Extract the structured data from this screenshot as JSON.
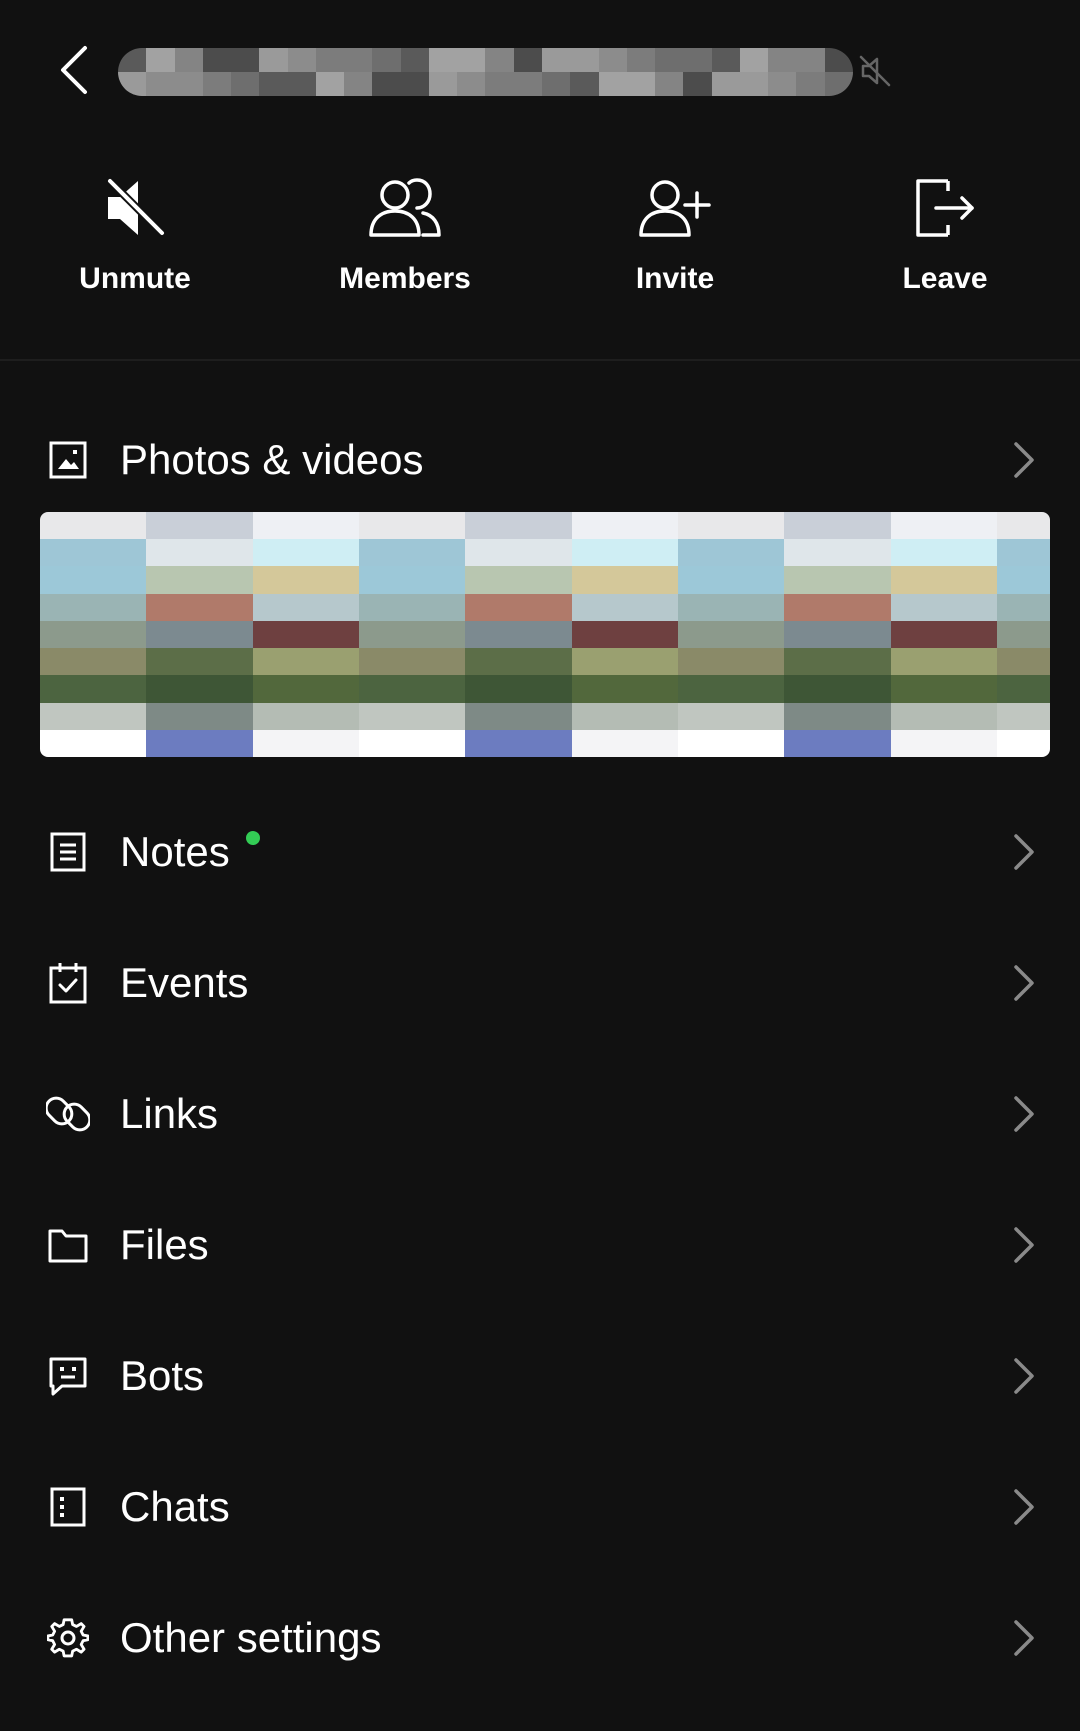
{
  "header": {
    "back_icon": "chevron-left-icon",
    "title_obscured": true,
    "mute_indicator_icon": "speaker-muted-icon"
  },
  "actions": [
    {
      "label": "Unmute",
      "icon": "speaker-muted-icon"
    },
    {
      "label": "Members",
      "icon": "members-icon"
    },
    {
      "label": "Invite",
      "icon": "add-person-icon"
    },
    {
      "label": "Leave",
      "icon": "exit-icon"
    }
  ],
  "menu": {
    "photos": {
      "label": "Photos & videos",
      "icon": "image-icon"
    },
    "notes": {
      "label": "Notes",
      "icon": "note-icon",
      "badge_color": "#33cc55"
    },
    "events": {
      "label": "Events",
      "icon": "calendar-check-icon"
    },
    "links": {
      "label": "Links",
      "icon": "link-icon"
    },
    "files": {
      "label": "Files",
      "icon": "folder-icon"
    },
    "bots": {
      "label": "Bots",
      "icon": "bot-icon"
    },
    "chats": {
      "label": "Chats",
      "icon": "chats-icon"
    },
    "settings": {
      "label": "Other settings",
      "icon": "gear-icon"
    }
  },
  "colors": {
    "background": "#111111",
    "text": "#ffffff",
    "chevron": "#8a8a8a",
    "badge": "#33cc55"
  }
}
